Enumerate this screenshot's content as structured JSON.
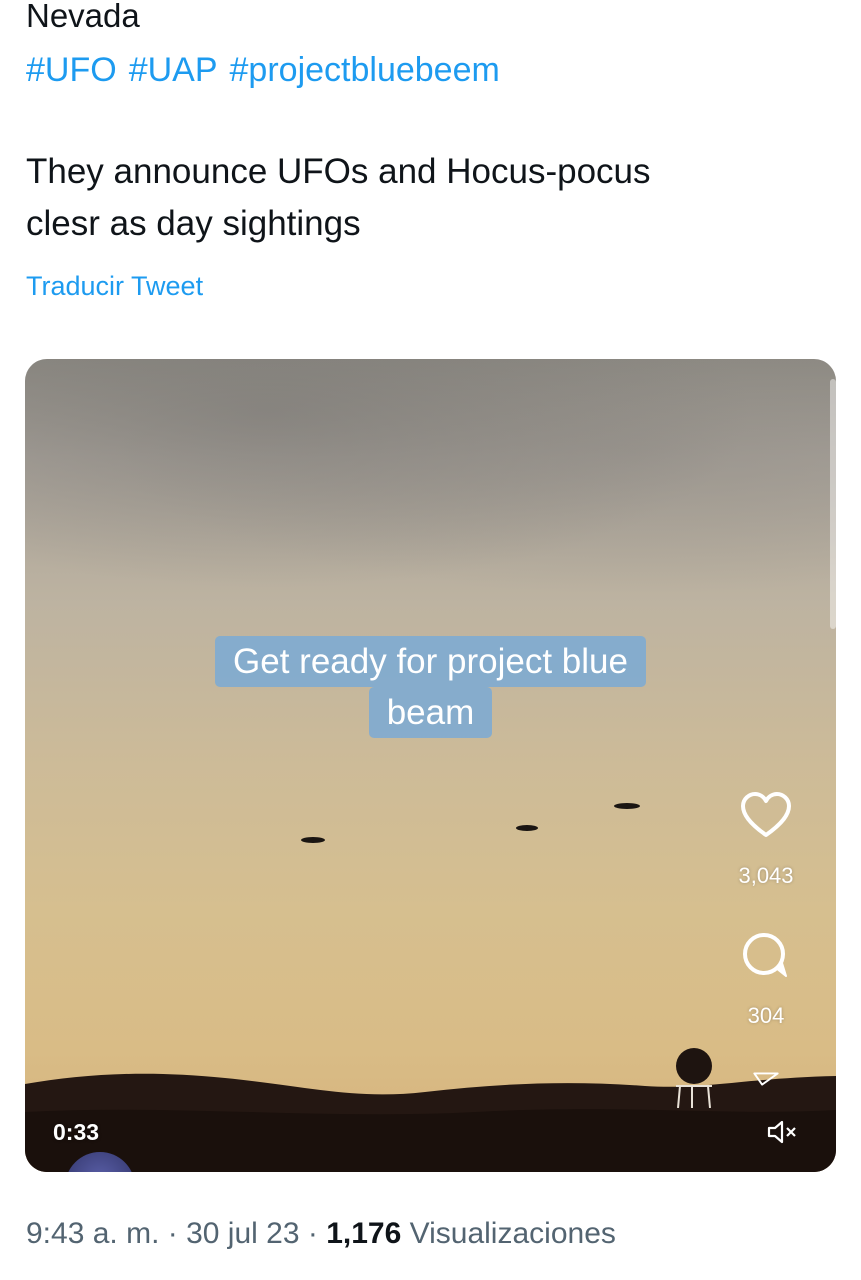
{
  "tweet": {
    "location_line": "Nevada",
    "hashtags": [
      "#UFO",
      "#UAP",
      "#projectbluebeem"
    ],
    "body_line1": "They announce UFOs and Hocus-pocus",
    "body_line2": "clesr as day sightings",
    "translate_label": "Traducir Tweet"
  },
  "video": {
    "caption_line1": "Get ready for project blue",
    "caption_line2": "beam",
    "duration": "0:33",
    "likes": "3,043",
    "comments": "304",
    "icons": {
      "like": "heart-icon",
      "comment": "comment-icon",
      "share": "share-icon",
      "mute": "mute-icon"
    }
  },
  "meta": {
    "time": "9:43 a. m.",
    "separator": "·",
    "date": "30 jul 23",
    "views_count": "1,176",
    "views_label": "Visualizaciones"
  },
  "colors": {
    "link": "#1d9bf0",
    "text": "#0f1419",
    "secondary_text": "#536471",
    "caption_bg": "#78aad7"
  }
}
